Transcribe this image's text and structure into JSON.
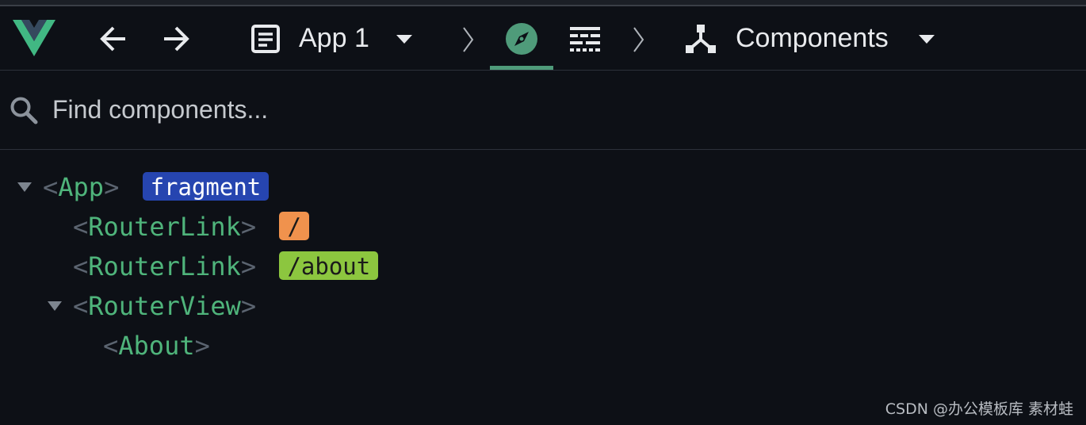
{
  "colors": {
    "background": "#0d1016",
    "accent": "#4f9b7a",
    "component_name": "#4fb47b",
    "bracket": "#5b6470",
    "badge_fragment_bg": "#2645b0",
    "badge_fragment_fg": "#ffffff",
    "badge_root_route_bg": "#f0924d",
    "badge_root_route_fg": "#1a1a1a",
    "badge_about_route_bg": "#8cc63f",
    "badge_about_route_fg": "#1a1a1a"
  },
  "toolbar": {
    "logo_icon": "vue-logo-icon",
    "back_icon": "arrow-left-icon",
    "forward_icon": "arrow-right-icon",
    "app_icon": "app-window-icon",
    "app_selector": {
      "label": "App 1",
      "icon": "chevron-down-icon"
    },
    "separator_icon": "chevron-right-icon",
    "inspector_icon": "compass-icon",
    "timeline_icon": "timeline-icon",
    "view_selector": {
      "label": "Components",
      "icon": "chevron-down-icon",
      "view_icon": "components-tree-icon"
    }
  },
  "search": {
    "icon": "search-icon",
    "placeholder": "Find components..."
  },
  "tree": [
    {
      "open": "<",
      "name": "App",
      "close": ">",
      "expanded": true,
      "badge": "fragment"
    },
    {
      "open": "<",
      "name": "RouterLink",
      "close": ">",
      "badge": "/"
    },
    {
      "open": "<",
      "name": "RouterLink",
      "close": ">",
      "badge": "/about"
    },
    {
      "open": "<",
      "name": "RouterView",
      "close": ">",
      "expanded": true
    },
    {
      "open": "<",
      "name": "About",
      "close": ">"
    }
  ],
  "watermark": "CSDN @办公模板库 素材蛙"
}
